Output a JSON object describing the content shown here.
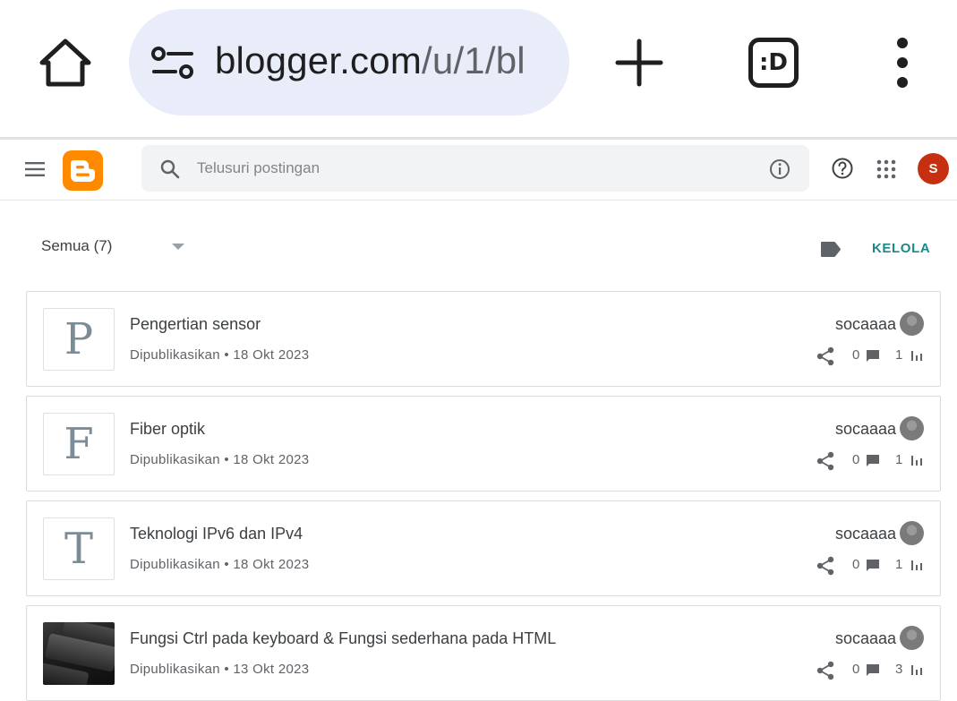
{
  "browser": {
    "url_host": "blogger.com",
    "url_rest": "/u/1/bl",
    "tabs_label": ":D"
  },
  "header": {
    "search_placeholder": "Telusuri postingan",
    "avatar_letter": "S"
  },
  "filter": {
    "label": "Semua (7)",
    "manage_label": "KELOLA"
  },
  "posts": [
    {
      "thumb": "P",
      "title": "Pengertian sensor",
      "status": "Dipublikasikan • 18 Okt 2023",
      "author": "socaaaa",
      "comments": "0",
      "views": "1"
    },
    {
      "thumb": "F",
      "title": "Fiber optik",
      "status": "Dipublikasikan • 18 Okt 2023",
      "author": "socaaaa",
      "comments": "0",
      "views": "1"
    },
    {
      "thumb": "T",
      "title": "Teknologi IPv6 dan IPv4",
      "status": "Dipublikasikan • 18 Okt 2023",
      "author": "socaaaa",
      "comments": "0",
      "views": "1"
    },
    {
      "thumb": "",
      "title": "Fungsi Ctrl pada keyboard & Fungsi sederhana pada HTML",
      "status": "Dipublikasikan • 13 Okt 2023",
      "author": "socaaaa",
      "comments": "0",
      "views": "3"
    }
  ],
  "colors": {
    "logo": "#ff8a00",
    "avatar": "#c62f0f",
    "accent": "#1a8a8a",
    "url_pill": "#e8edf9"
  }
}
